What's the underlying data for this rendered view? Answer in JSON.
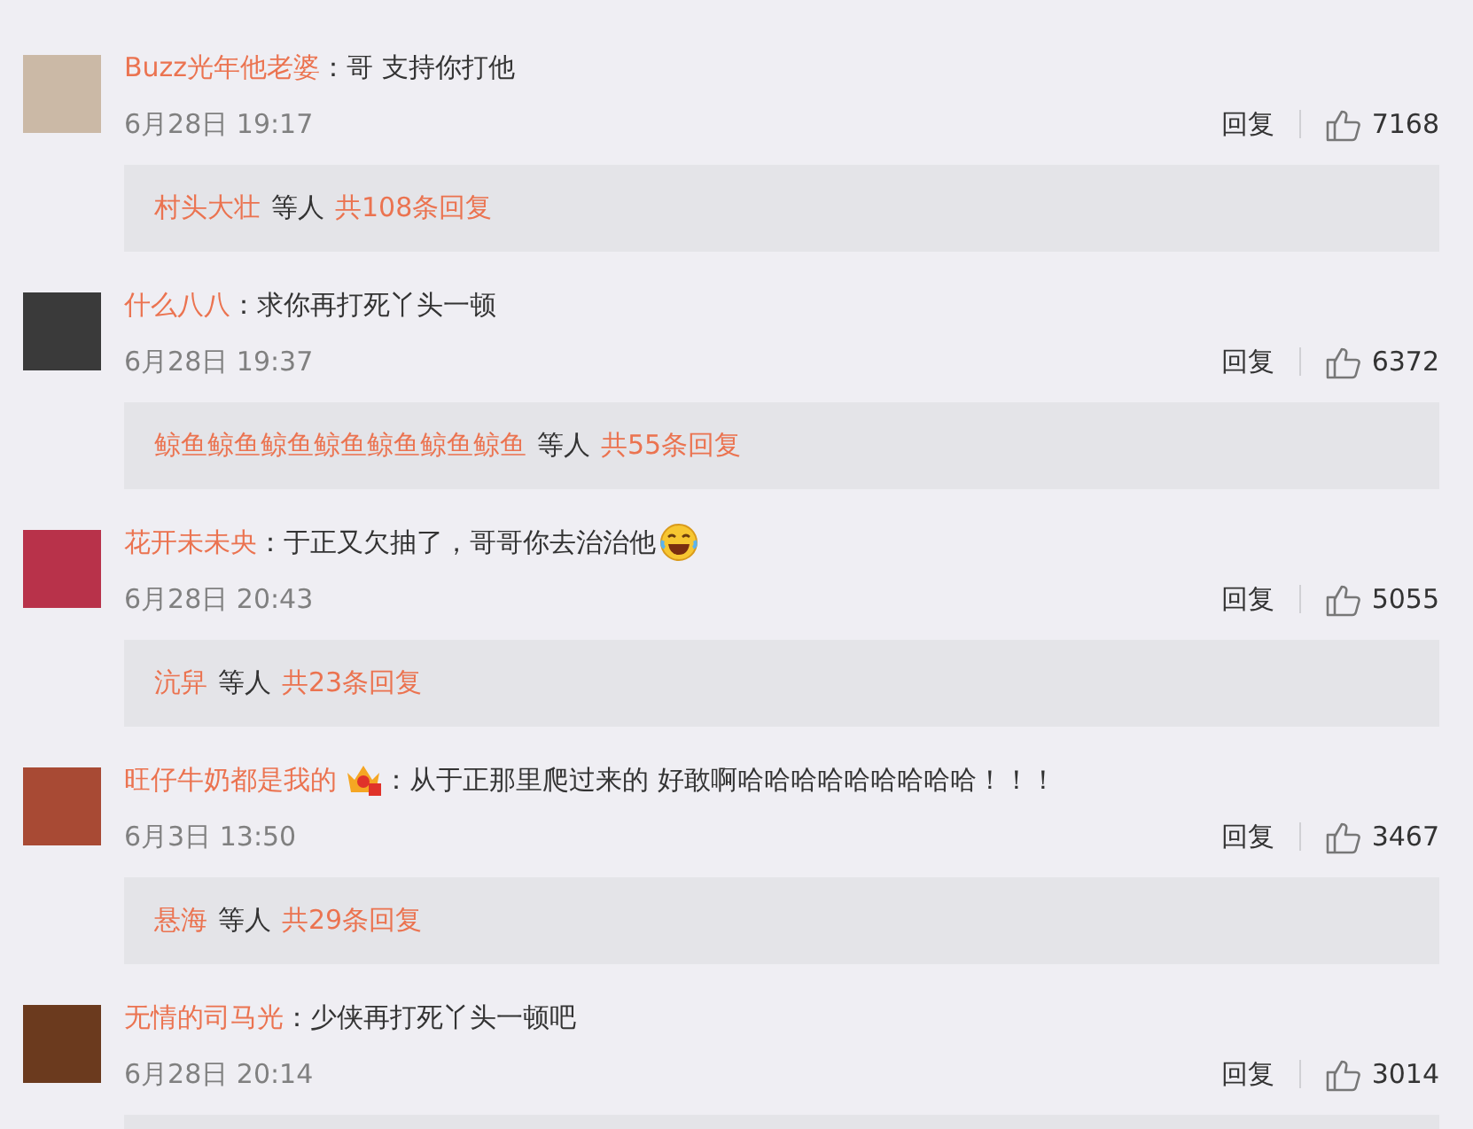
{
  "comments": [
    {
      "author": "Buzz光年他老婆",
      "text": "：哥 支持你打他",
      "time": "6月28日 19:17",
      "reply_label": "回复",
      "likes": "7168",
      "thread": {
        "first": "村头大壮",
        "and_others": "等人",
        "count": "共108条回复"
      }
    },
    {
      "author": "什么八八",
      "text": "：求你再打死丫头一顿",
      "time": "6月28日 19:37",
      "reply_label": "回复",
      "likes": "6372",
      "thread": {
        "first": "鲸鱼鲸鱼鲸鱼鲸鱼鲸鱼鲸鱼鲸鱼",
        "and_others": "等人",
        "count": "共55条回复"
      }
    },
    {
      "author": "花开未未央",
      "text": "：于正又欠抽了，哥哥你去治治他",
      "trailing_emoji": true,
      "time": "6月28日 20:43",
      "reply_label": "回复",
      "likes": "5055",
      "thread": {
        "first": "沆舁",
        "and_others": "等人",
        "count": "共23条回复"
      }
    },
    {
      "author": "旺仔牛奶都是我的",
      "badge": true,
      "text": "：从于正那里爬过来的 好敢啊哈哈哈哈哈哈哈哈哈！！！",
      "time": "6月3日 13:50",
      "reply_label": "回复",
      "likes": "3467",
      "thread": {
        "first": "悬海",
        "and_others": "等人",
        "count": "共29条回复"
      }
    },
    {
      "author": "无情的司马光",
      "text": "：少侠再打死丫头一顿吧",
      "time": "6月28日 20:14",
      "reply_label": "回复",
      "likes": "3014",
      "thread_cut": true
    }
  ]
}
